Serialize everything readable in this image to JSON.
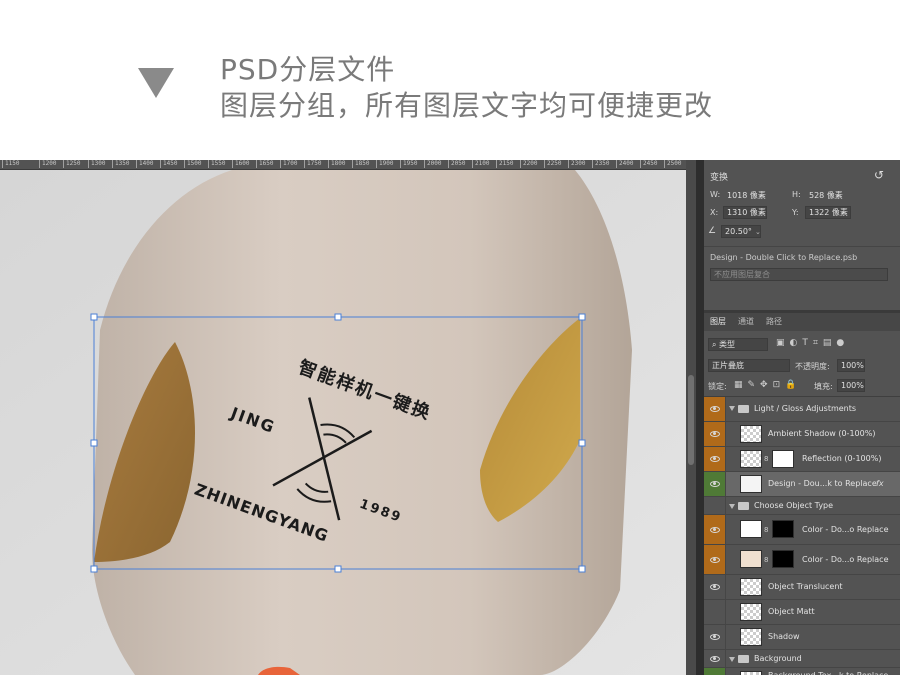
{
  "header": {
    "line1": "PSD分层文件",
    "line2": "图层分组，所有图层文字均可便捷更改"
  },
  "ruler": {
    "ticks": [
      "1150",
      "1200",
      "1250",
      "1300",
      "1350",
      "1400",
      "1450",
      "1500",
      "1550",
      "1600",
      "1650",
      "1700",
      "1750",
      "1800",
      "1850",
      "1900",
      "1950",
      "2000",
      "2050",
      "2100",
      "2150",
      "2200",
      "2250",
      "2300",
      "2350",
      "2400",
      "2450",
      "2500"
    ]
  },
  "artwork": {
    "cn_title": "智能样机一键换",
    "line1": "JING",
    "line2": "ZHINENGYANG",
    "year": "1989"
  },
  "properties": {
    "title": "变换",
    "w_label": "W:",
    "w_value": "1018 像素",
    "h_label": "H:",
    "h_value": "528 像素",
    "x_label": "X:",
    "x_value": "1310 像素",
    "y_label": "Y:",
    "y_value": "1322 像素",
    "angle": "20.50°",
    "smart_object": "Design - Double Click to Replace.psb",
    "comp_placeholder": "不应用图层复合"
  },
  "layers_panel": {
    "tabs": [
      "图层",
      "通道",
      "路径"
    ],
    "filter": "类型",
    "blend_mode": "正片叠底",
    "opacity_label": "不透明度:",
    "opacity_value": "100%",
    "lock_label": "锁定:",
    "fill_label": "填充:",
    "fill_value": "100%",
    "fx": "fx"
  },
  "layers": [
    {
      "name": "Light / Gloss Adjustments",
      "kind": "group"
    },
    {
      "name": "Ambient Shadow (0-100%)",
      "kind": "layer"
    },
    {
      "name": "Reflection (0-100%)",
      "kind": "layer"
    },
    {
      "name": "Design - Dou...k to Replace",
      "kind": "smart"
    },
    {
      "name": "Choose Object Type",
      "kind": "group"
    },
    {
      "name": "Color - Do...o Replace",
      "kind": "layer"
    },
    {
      "name": "Color - Do...o Replace",
      "kind": "layer"
    },
    {
      "name": "Object Translucent",
      "kind": "layer"
    },
    {
      "name": "Object Matt",
      "kind": "layer"
    },
    {
      "name": "Shadow",
      "kind": "layer"
    },
    {
      "name": "Background",
      "kind": "group"
    },
    {
      "name": "Background Tex...k to Replace",
      "kind": "layer"
    }
  ],
  "colors": {
    "accent_orange": "#b06a1a",
    "accent_green": "#4f7a36",
    "bottle": "#d8ccc2",
    "gold": "#b98a3a",
    "selection": "#4a7fd6"
  }
}
